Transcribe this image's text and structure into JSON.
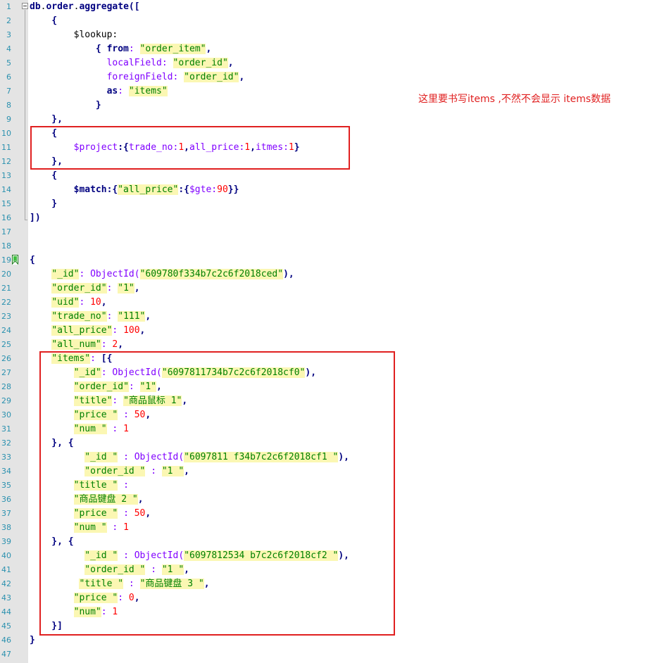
{
  "editor": {
    "line_numbers": [
      "1",
      "2",
      "3",
      "4",
      "5",
      "6",
      "7",
      "8",
      "9",
      "10",
      "11",
      "12",
      "13",
      "14",
      "15",
      "16",
      "17",
      "18",
      "19",
      "20",
      "21",
      "22",
      "23",
      "24",
      "25",
      "26",
      "27",
      "28",
      "29",
      "30",
      "31",
      "32",
      "33",
      "34",
      "35",
      "36",
      "37",
      "38",
      "39",
      "40",
      "41",
      "42",
      "43",
      "44",
      "45",
      "46",
      "47"
    ],
    "lines": [
      [
        {
          "t": "db",
          "c": "k"
        },
        {
          "t": ".",
          "c": "t"
        },
        {
          "t": "order",
          "c": "k"
        },
        {
          "t": ".",
          "c": "t"
        },
        {
          "t": "aggregate",
          "c": "k"
        },
        {
          "t": "([",
          "c": "k"
        }
      ],
      [
        {
          "t": "    {",
          "c": "k"
        }
      ],
      [
        {
          "t": "        $lookup:",
          "c": "t"
        }
      ],
      [
        {
          "t": "            { ",
          "c": "k"
        },
        {
          "t": "from",
          "c": "k"
        },
        {
          "t": ": ",
          "c": "p"
        },
        {
          "t": "\"order_item\"",
          "c": "s"
        },
        {
          "t": ",",
          "c": "k"
        }
      ],
      [
        {
          "t": "              localField",
          "c": "p"
        },
        {
          "t": ": ",
          "c": "p"
        },
        {
          "t": "\"order_id\"",
          "c": "s"
        },
        {
          "t": ",",
          "c": "k"
        }
      ],
      [
        {
          "t": "              foreignField",
          "c": "p"
        },
        {
          "t": ": ",
          "c": "p"
        },
        {
          "t": "\"order_id\"",
          "c": "s"
        },
        {
          "t": ",",
          "c": "k"
        }
      ],
      [
        {
          "t": "              ",
          "c": "t"
        },
        {
          "t": "as",
          "c": "k"
        },
        {
          "t": ": ",
          "c": "p"
        },
        {
          "t": "\"items\"",
          "c": "s"
        }
      ],
      [
        {
          "t": "            }",
          "c": "k"
        }
      ],
      [
        {
          "t": "    },",
          "c": "k"
        }
      ],
      [
        {
          "t": "    {",
          "c": "k"
        }
      ],
      [
        {
          "t": "        $project",
          "c": "p"
        },
        {
          "t": ":{",
          "c": "k"
        },
        {
          "t": "trade_no",
          "c": "p"
        },
        {
          "t": ":",
          "c": "p"
        },
        {
          "t": "1",
          "c": "n"
        },
        {
          "t": ",",
          "c": "k"
        },
        {
          "t": "all_price",
          "c": "p"
        },
        {
          "t": ":",
          "c": "p"
        },
        {
          "t": "1",
          "c": "n"
        },
        {
          "t": ",",
          "c": "k"
        },
        {
          "t": "itmes",
          "c": "p"
        },
        {
          "t": ":",
          "c": "p"
        },
        {
          "t": "1",
          "c": "n"
        },
        {
          "t": "}",
          "c": "k"
        }
      ],
      [
        {
          "t": "    },",
          "c": "k"
        }
      ],
      [
        {
          "t": "    {",
          "c": "k"
        }
      ],
      [
        {
          "t": "        $match",
          "c": "k"
        },
        {
          "t": ":{",
          "c": "k"
        },
        {
          "t": "\"all_price\"",
          "c": "s"
        },
        {
          "t": ":{",
          "c": "k"
        },
        {
          "t": "$gte",
          "c": "p"
        },
        {
          "t": ":",
          "c": "p"
        },
        {
          "t": "90",
          "c": "n"
        },
        {
          "t": "}}",
          "c": "k"
        }
      ],
      [
        {
          "t": "    }",
          "c": "k"
        }
      ],
      [
        {
          "t": "])",
          "c": "k"
        }
      ],
      [],
      [],
      [
        {
          "t": "{",
          "c": "k"
        }
      ],
      [
        {
          "t": "    ",
          "c": "t"
        },
        {
          "t": "\"_id\"",
          "c": "s"
        },
        {
          "t": ": ",
          "c": "p"
        },
        {
          "t": "ObjectId(",
          "c": "p"
        },
        {
          "t": "\"609780f334b7c2c6f2018ced\"",
          "c": "s"
        },
        {
          "t": "),",
          "c": "k"
        }
      ],
      [
        {
          "t": "    ",
          "c": "t"
        },
        {
          "t": "\"order_id\"",
          "c": "s"
        },
        {
          "t": ": ",
          "c": "p"
        },
        {
          "t": "\"1\"",
          "c": "s"
        },
        {
          "t": ",",
          "c": "k"
        }
      ],
      [
        {
          "t": "    ",
          "c": "t"
        },
        {
          "t": "\"uid\"",
          "c": "s"
        },
        {
          "t": ": ",
          "c": "p"
        },
        {
          "t": "10",
          "c": "n"
        },
        {
          "t": ",",
          "c": "k"
        }
      ],
      [
        {
          "t": "    ",
          "c": "t"
        },
        {
          "t": "\"trade_no\"",
          "c": "s"
        },
        {
          "t": ": ",
          "c": "p"
        },
        {
          "t": "\"111\"",
          "c": "s"
        },
        {
          "t": ",",
          "c": "k"
        }
      ],
      [
        {
          "t": "    ",
          "c": "t"
        },
        {
          "t": "\"all_price\"",
          "c": "s"
        },
        {
          "t": ": ",
          "c": "p"
        },
        {
          "t": "100",
          "c": "n"
        },
        {
          "t": ",",
          "c": "k"
        }
      ],
      [
        {
          "t": "    ",
          "c": "t"
        },
        {
          "t": "\"all_num\"",
          "c": "s"
        },
        {
          "t": ": ",
          "c": "p"
        },
        {
          "t": "2",
          "c": "n"
        },
        {
          "t": ",",
          "c": "k"
        }
      ],
      [
        {
          "t": "    ",
          "c": "t"
        },
        {
          "t": "\"items\"",
          "c": "s"
        },
        {
          "t": ": ",
          "c": "p"
        },
        {
          "t": "[{",
          "c": "k"
        }
      ],
      [
        {
          "t": "        ",
          "c": "t"
        },
        {
          "t": "\"_id\"",
          "c": "s"
        },
        {
          "t": ": ",
          "c": "p"
        },
        {
          "t": "ObjectId(",
          "c": "p"
        },
        {
          "t": "\"6097811734b7c2c6f2018cf0\"",
          "c": "s"
        },
        {
          "t": "),",
          "c": "k"
        }
      ],
      [
        {
          "t": "        ",
          "c": "t"
        },
        {
          "t": "\"order_id\"",
          "c": "s"
        },
        {
          "t": ": ",
          "c": "p"
        },
        {
          "t": "\"1\"",
          "c": "s"
        },
        {
          "t": ",",
          "c": "k"
        }
      ],
      [
        {
          "t": "        ",
          "c": "t"
        },
        {
          "t": "\"title\"",
          "c": "s"
        },
        {
          "t": ": ",
          "c": "p"
        },
        {
          "t": "\"商品鼠标 1\"",
          "c": "s"
        },
        {
          "t": ",",
          "c": "k"
        }
      ],
      [
        {
          "t": "        ",
          "c": "t"
        },
        {
          "t": "\"price \"",
          "c": "s"
        },
        {
          "t": " : ",
          "c": "p"
        },
        {
          "t": "50",
          "c": "n"
        },
        {
          "t": ",",
          "c": "k"
        }
      ],
      [
        {
          "t": "        ",
          "c": "t"
        },
        {
          "t": "\"num \"",
          "c": "s"
        },
        {
          "t": " : ",
          "c": "p"
        },
        {
          "t": "1",
          "c": "n"
        }
      ],
      [
        {
          "t": "    }, {",
          "c": "k"
        }
      ],
      [
        {
          "t": "          ",
          "c": "t"
        },
        {
          "t": "\"_id \"",
          "c": "s"
        },
        {
          "t": " : ",
          "c": "p"
        },
        {
          "t": "ObjectId(",
          "c": "p"
        },
        {
          "t": "\"6097811 f34b7c2c6f2018cf1 \"",
          "c": "s"
        },
        {
          "t": "),",
          "c": "k"
        }
      ],
      [
        {
          "t": "          ",
          "c": "t"
        },
        {
          "t": "\"order_id \"",
          "c": "s"
        },
        {
          "t": " : ",
          "c": "p"
        },
        {
          "t": "\"1 \"",
          "c": "s"
        },
        {
          "t": ",",
          "c": "k"
        }
      ],
      [
        {
          "t": "        ",
          "c": "t"
        },
        {
          "t": "\"title \"",
          "c": "s"
        },
        {
          "t": " :",
          "c": "p"
        }
      ],
      [
        {
          "t": "        ",
          "c": "t"
        },
        {
          "t": "\"商品键盘 2 \"",
          "c": "s"
        },
        {
          "t": ",",
          "c": "k"
        }
      ],
      [
        {
          "t": "        ",
          "c": "t"
        },
        {
          "t": "\"price \"",
          "c": "s"
        },
        {
          "t": " : ",
          "c": "p"
        },
        {
          "t": "50",
          "c": "n"
        },
        {
          "t": ",",
          "c": "k"
        }
      ],
      [
        {
          "t": "        ",
          "c": "t"
        },
        {
          "t": "\"num \"",
          "c": "s"
        },
        {
          "t": " : ",
          "c": "p"
        },
        {
          "t": "1",
          "c": "n"
        }
      ],
      [
        {
          "t": "    }, {",
          "c": "k"
        }
      ],
      [
        {
          "t": "          ",
          "c": "t"
        },
        {
          "t": "\"_id \"",
          "c": "s"
        },
        {
          "t": " : ",
          "c": "p"
        },
        {
          "t": "ObjectId(",
          "c": "p"
        },
        {
          "t": "\"6097812534 b7c2c6f2018cf2 \"",
          "c": "s"
        },
        {
          "t": "),",
          "c": "k"
        }
      ],
      [
        {
          "t": "          ",
          "c": "t"
        },
        {
          "t": "\"order_id \"",
          "c": "s"
        },
        {
          "t": " : ",
          "c": "p"
        },
        {
          "t": "\"1 \"",
          "c": "s"
        },
        {
          "t": ",",
          "c": "k"
        }
      ],
      [
        {
          "t": "         ",
          "c": "t"
        },
        {
          "t": "\"title \"",
          "c": "s"
        },
        {
          "t": " : ",
          "c": "p"
        },
        {
          "t": "\"商品键盘 3 \"",
          "c": "s"
        },
        {
          "t": ",",
          "c": "k"
        }
      ],
      [
        {
          "t": "        ",
          "c": "t"
        },
        {
          "t": "\"price \"",
          "c": "s"
        },
        {
          "t": ": ",
          "c": "p"
        },
        {
          "t": "0",
          "c": "n"
        },
        {
          "t": ",",
          "c": "k"
        }
      ],
      [
        {
          "t": "        ",
          "c": "t"
        },
        {
          "t": "\"num\"",
          "c": "s"
        },
        {
          "t": ": ",
          "c": "p"
        },
        {
          "t": "1",
          "c": "n"
        }
      ],
      [
        {
          "t": "    }]",
          "c": "k"
        }
      ],
      [
        {
          "t": "}",
          "c": "k"
        }
      ],
      []
    ]
  },
  "annotation": {
    "note": "这里要书写items ,不然不会显示 items数据"
  },
  "icons": {
    "fold": "fold-minus-icon",
    "bookmark": "bookmark-icon"
  },
  "colors": {
    "highlight_box": "#e02020",
    "string_bg": "#fbf7b3",
    "line_number": "#2b91af"
  }
}
